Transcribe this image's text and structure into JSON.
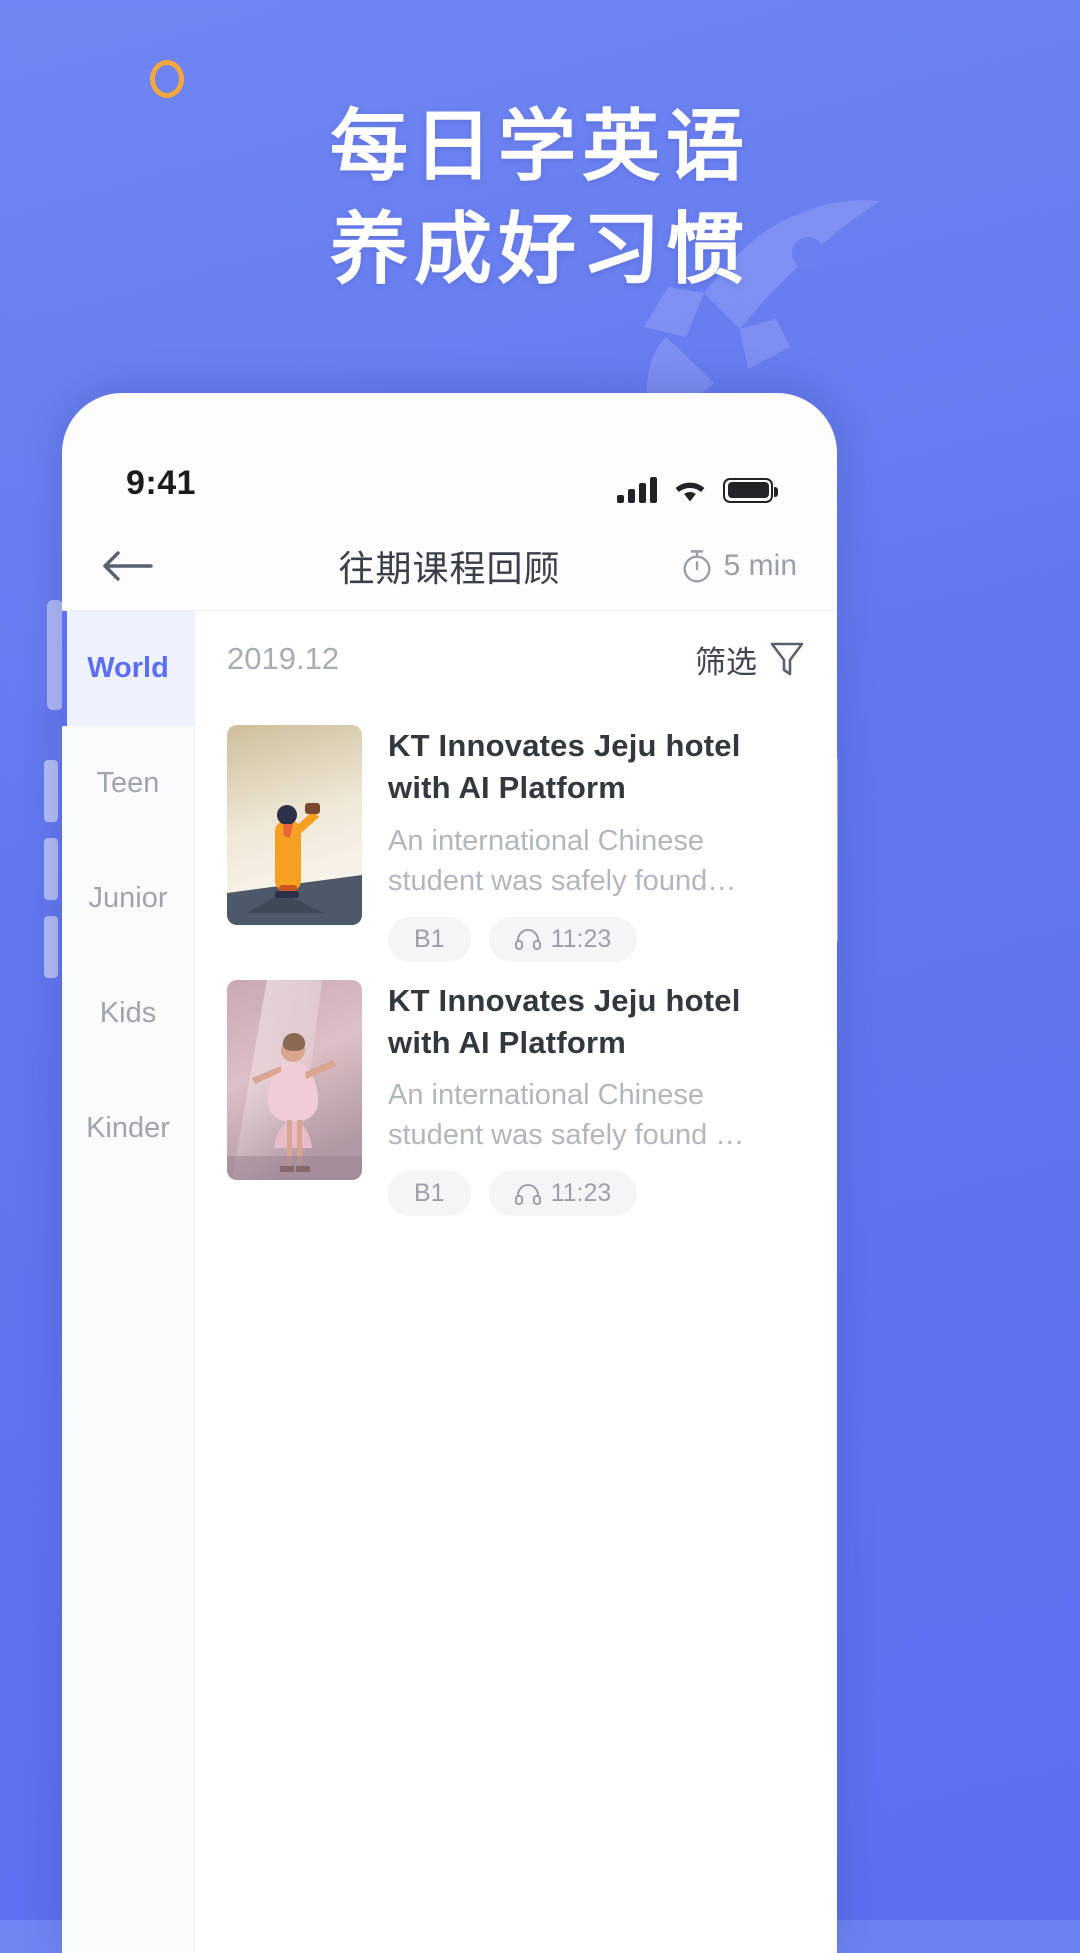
{
  "promo": {
    "headline_line1": "每日学英语",
    "headline_line2": "养成好习惯",
    "accent_color": "#f7a73c",
    "background_color": "#6276ee",
    "ring_icon": "circle-outline-icon",
    "rocket_icon": "rocket-icon"
  },
  "phone": {
    "status_bar": {
      "time": "9:41",
      "signal_icon": "cellular-signal-icon",
      "wifi_icon": "wifi-icon",
      "battery_icon": "battery-full-icon"
    },
    "navbar": {
      "back_icon": "arrow-left-icon",
      "title": "往期课程回顾",
      "duration_icon": "stopwatch-icon",
      "duration": "5 min"
    },
    "sidebar": {
      "active_index": 0,
      "active_color": "#5b6ef5",
      "items": [
        {
          "label": "World"
        },
        {
          "label": "Teen"
        },
        {
          "label": "Junior"
        },
        {
          "label": "Kids"
        },
        {
          "label": "Kinder"
        }
      ]
    },
    "list_header": {
      "date": "2019.12",
      "filter_label": "筛选",
      "filter_icon": "funnel-icon"
    },
    "lessons": [
      {
        "title": "KT Innovates Jeju hotel with AI Platform",
        "description": "An international Chinese student was safely found…",
        "level_tag": "B1",
        "audio_icon": "headphones-icon",
        "duration": "11:23",
        "thumbnail_name": "illustration-man-in-orange-coat"
      },
      {
        "title": "KT Innovates Jeju hotel with AI Platform",
        "description": "An international Chinese student was safely found …",
        "level_tag": "B1",
        "audio_icon": "headphones-icon",
        "duration": "11:23",
        "thumbnail_name": "photo-girl-dancing-pink-dress"
      }
    ]
  }
}
